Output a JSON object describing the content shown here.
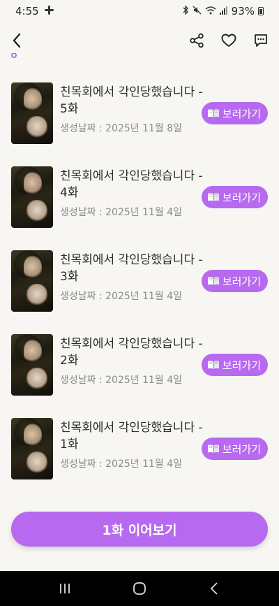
{
  "status": {
    "time": "4:55",
    "battery": "93%",
    "icons": [
      "slack-icon",
      "bluetooth-icon",
      "mute-icon",
      "wifi-icon",
      "signal-icon",
      "battery-icon"
    ]
  },
  "app_bar": {
    "icons": [
      "back-icon",
      "share-icon",
      "heart-icon",
      "comment-icon"
    ]
  },
  "accent_color": "#b76af0",
  "episodes": [
    {
      "title": "친목회에서 각인당했습니다 - 5화",
      "date": "생성날짜 : 2025년 11월 8일",
      "button": "보러가기"
    },
    {
      "title": "친목회에서 각인당했습니다 - 4화",
      "date": "생성날짜 : 2025년 11월 4일",
      "button": "보러가기"
    },
    {
      "title": "친목회에서 각인당했습니다 - 3화",
      "date": "생성날짜 : 2025년 11월 4일",
      "button": "보러가기"
    },
    {
      "title": "친목회에서 각인당했습니다 - 2화",
      "date": "생성날짜 : 2025년 11월 4일",
      "button": "보러가기"
    },
    {
      "title": "친목회에서 각인당했습니다 - 1화",
      "date": "생성날짜 : 2025년 11월 4일",
      "button": "보러가기"
    }
  ],
  "continue_button": "1화 이어보기"
}
